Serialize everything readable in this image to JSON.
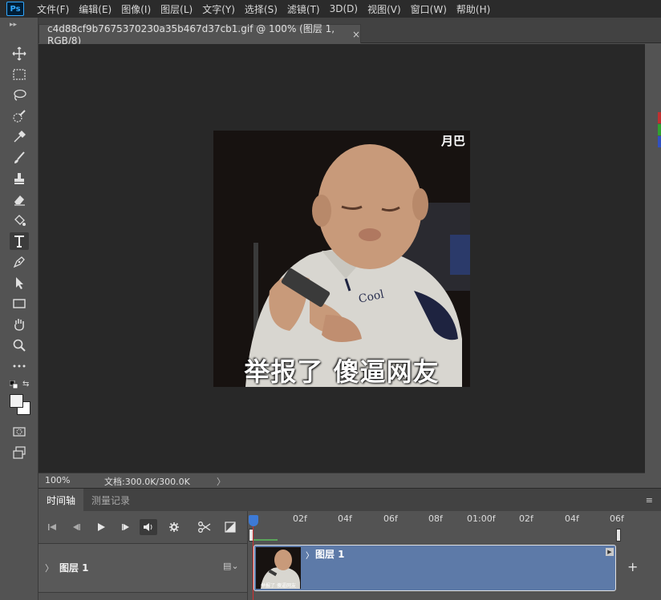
{
  "menu": {
    "logo": "Ps",
    "items": [
      "文件(F)",
      "编辑(E)",
      "图像(I)",
      "图层(L)",
      "文字(Y)",
      "选择(S)",
      "滤镜(T)",
      "3D(D)",
      "视图(V)",
      "窗口(W)",
      "帮助(H)"
    ]
  },
  "document": {
    "tab_title": "c4d88cf9b7675370230a35b467d37cb1.gif @ 100% (图层 1, RGB/8)",
    "close_glyph": "×",
    "image_watermark": "月巴",
    "image_caption": "举报了 傻逼网友"
  },
  "status": {
    "zoom": "100%",
    "doc_info": "文档:300.0K/300.0K",
    "arrow": "〉"
  },
  "timeline": {
    "tabs": [
      "时间轴",
      "测量记录"
    ],
    "ruler_labels": [
      "02f",
      "04f",
      "06f",
      "08f",
      "01:00f",
      "02f",
      "04f",
      "06f"
    ],
    "track_name": "图层 1",
    "clip_name": "图层 1",
    "clip_thumb_caption": "举报了 傻逼网友",
    "add_glyph": "+"
  },
  "colors": {
    "accent": "#31a8ff",
    "clip": "#5d7aa8",
    "playhead": "#3d7ad6"
  }
}
